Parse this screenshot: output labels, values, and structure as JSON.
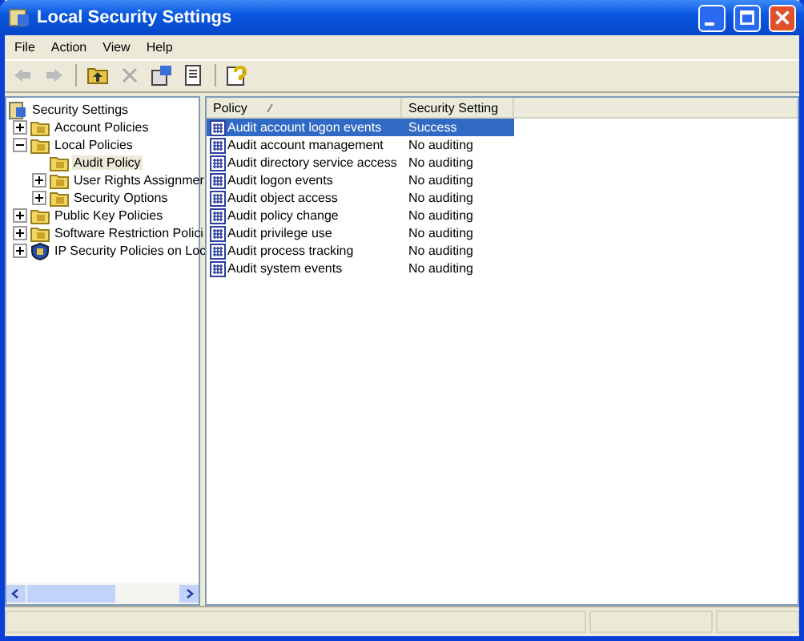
{
  "window": {
    "title": "Local Security Settings"
  },
  "menu": [
    "File",
    "Action",
    "View",
    "Help"
  ],
  "tree": {
    "label": "Security Settings",
    "kind": "root",
    "selected": false,
    "children": [
      {
        "label": "Account Policies",
        "kind": "folder",
        "expanded": false,
        "selected": false
      },
      {
        "label": "Local Policies",
        "kind": "folder",
        "expanded": true,
        "selected": false,
        "children": [
          {
            "label": "Audit Policy",
            "kind": "folder",
            "selected": true
          },
          {
            "label": "User Rights Assignmer",
            "kind": "folder",
            "expanded": false,
            "selected": false
          },
          {
            "label": "Security Options",
            "kind": "folder",
            "expanded": false,
            "selected": false
          }
        ]
      },
      {
        "label": "Public Key Policies",
        "kind": "folder",
        "expanded": false,
        "selected": false
      },
      {
        "label": "Software Restriction Polici",
        "kind": "folder",
        "expanded": false,
        "selected": false
      },
      {
        "label": "IP Security Policies on Loc",
        "kind": "shield",
        "expanded": false,
        "selected": false
      }
    ]
  },
  "table": {
    "columns": [
      "Policy",
      "Security Setting"
    ],
    "rows": [
      {
        "policy": "Audit account logon events",
        "setting": "Success",
        "selected": true
      },
      {
        "policy": "Audit account management",
        "setting": "No auditing",
        "selected": false
      },
      {
        "policy": "Audit directory service access",
        "setting": "No auditing",
        "selected": false
      },
      {
        "policy": "Audit logon events",
        "setting": "No auditing",
        "selected": false
      },
      {
        "policy": "Audit object access",
        "setting": "No auditing",
        "selected": false
      },
      {
        "policy": "Audit policy change",
        "setting": "No auditing",
        "selected": false
      },
      {
        "policy": "Audit privilege use",
        "setting": "No auditing",
        "selected": false
      },
      {
        "policy": "Audit process tracking",
        "setting": "No auditing",
        "selected": false
      },
      {
        "policy": "Audit system events",
        "setting": "No auditing",
        "selected": false
      }
    ]
  }
}
